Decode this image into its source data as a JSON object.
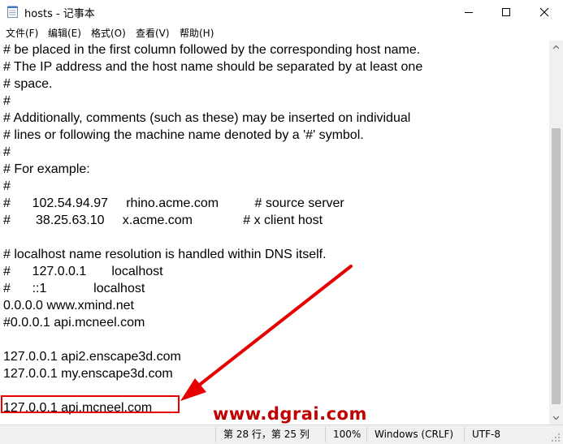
{
  "window": {
    "title": "hosts - 记事本",
    "controls": {
      "minimize": "minimize",
      "maximize": "maximize",
      "close": "close"
    }
  },
  "menu": [
    "文件(F)",
    "编辑(E)",
    "格式(O)",
    "查看(V)",
    "帮助(H)"
  ],
  "editor": {
    "lines": [
      "# be placed in the first column followed by the corresponding host name.",
      "# The IP address and the host name should be separated by at least one",
      "# space.",
      "#",
      "# Additionally, comments (such as these) may be inserted on individual",
      "# lines or following the machine name denoted by a '#' symbol.",
      "#",
      "# For example:",
      "#",
      "#      102.54.94.97     rhino.acme.com          # source server",
      "#       38.25.63.10     x.acme.com              # x client host",
      "",
      "# localhost name resolution is handled within DNS itself.",
      "#\t127.0.0.1       localhost",
      "#\t::1             localhost",
      "0.0.0.0 www.xmind.net",
      "#0.0.0.1 api.mcneel.com",
      "",
      "127.0.0.1 api2.enscape3d.com",
      "127.0.0.1 my.enscape3d.com",
      "",
      "127.0.0.1 api.mcneel.com"
    ]
  },
  "status": {
    "position": "第 28 行，第 25 列",
    "zoom": "100%",
    "line_ending": "Windows (CRLF)",
    "encoding": "UTF-8"
  },
  "watermark": "www.dgrai.com",
  "colors": {
    "annotation_red": "#e60000",
    "watermark_red": "#c00000"
  }
}
